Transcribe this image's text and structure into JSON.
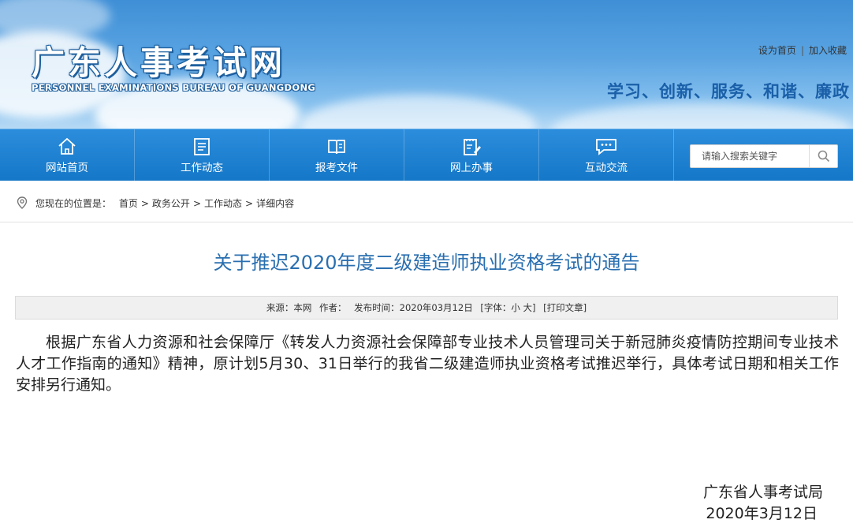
{
  "header": {
    "logo_cn": "广东人事考试网",
    "logo_en": "PERSONNEL EXAMINATIONS BUREAU OF GUANGDONG",
    "set_home": "设为首页",
    "link_sep": "|",
    "add_favorite": "加入收藏",
    "slogan": "学习、创新、服务、和谐、廉政"
  },
  "nav": {
    "items": [
      {
        "label": "网站首页",
        "icon": "home-icon"
      },
      {
        "label": "工作动态",
        "icon": "news-icon"
      },
      {
        "label": "报考文件",
        "icon": "book-icon"
      },
      {
        "label": "网上办事",
        "icon": "edit-doc-icon"
      },
      {
        "label": "互动交流",
        "icon": "chat-icon"
      }
    ],
    "search_placeholder": "请输入搜索关键字"
  },
  "breadcrumb": {
    "prefix": "您现在的位置是：",
    "items": [
      "首页",
      "政务公开",
      "工作动态",
      "详细内容"
    ],
    "sep": ">"
  },
  "article": {
    "title": "关于推迟2020年度二级建造师执业资格考试的通告",
    "meta": {
      "source": "来源：本网",
      "author": "作者：",
      "published": "发布时间：2020年03月12日",
      "font_size": "[字体：小 大]",
      "print": "[打印文章]"
    },
    "body": "根据广东省人力资源和社会保障厅《转发人力资源社会保障部专业技术人员管理司关于新冠肺炎疫情防控期间专业技术人才工作指南的通知》精神，原计划5月30、31日举行的我省二级建造师执业资格考试推迟举行，具体考试日期和相关工作安排另行通知。",
    "signature_org": "广东省人事考试局",
    "signature_date": "2020年3月12日"
  },
  "colors": {
    "nav_bg": "#1a7fd0",
    "title_blue": "#2a6fb0",
    "slogan_blue": "#1a5fa8"
  }
}
